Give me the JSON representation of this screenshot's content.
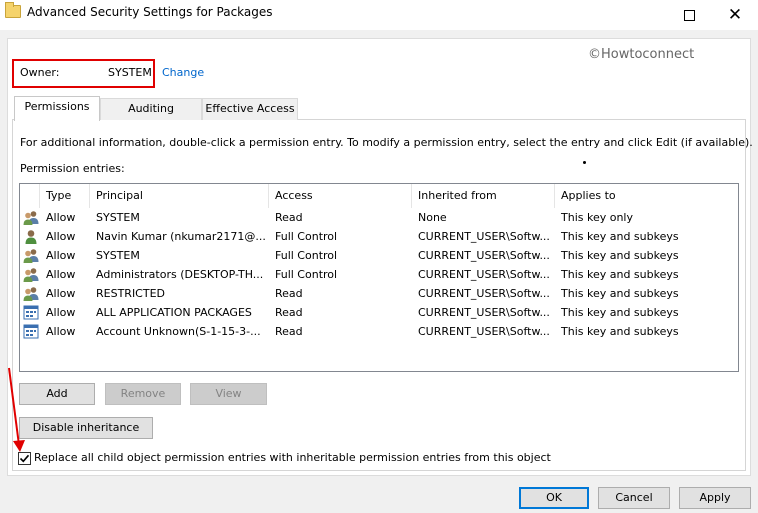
{
  "window": {
    "title": "Advanced Security Settings for Packages",
    "controls": {
      "maximize_icon": "maximize-icon",
      "close_label": "✕"
    }
  },
  "watermark": "©Howtoconnect",
  "owner": {
    "label": "Owner:",
    "value": "SYSTEM",
    "change_link": "Change",
    "highlight_color": "#e00000"
  },
  "tabs": [
    {
      "label": "Permissions",
      "active": true
    },
    {
      "label": "Auditing",
      "active": false
    },
    {
      "label": "Effective Access",
      "active": false
    }
  ],
  "info_text": "For additional information, double-click a permission entry. To modify a permission entry, select the entry and click Edit (if available).",
  "entries_label": "Permission entries:",
  "table": {
    "columns": [
      "Type",
      "Principal",
      "Access",
      "Inherited from",
      "Applies to"
    ],
    "rows": [
      {
        "icon": "group-icon",
        "type": "Allow",
        "principal": "SYSTEM",
        "access": "Read",
        "inherited": "None",
        "applies": "This key only"
      },
      {
        "icon": "user-icon",
        "type": "Allow",
        "principal": "Navin Kumar (nkumar2171@...",
        "access": "Full Control",
        "inherited": "CURRENT_USER\\Softw...",
        "applies": "This key and subkeys"
      },
      {
        "icon": "group-icon",
        "type": "Allow",
        "principal": "SYSTEM",
        "access": "Full Control",
        "inherited": "CURRENT_USER\\Softw...",
        "applies": "This key and subkeys"
      },
      {
        "icon": "group-icon",
        "type": "Allow",
        "principal": "Administrators (DESKTOP-TH...",
        "access": "Full Control",
        "inherited": "CURRENT_USER\\Softw...",
        "applies": "This key and subkeys"
      },
      {
        "icon": "group-icon",
        "type": "Allow",
        "principal": "RESTRICTED",
        "access": "Read",
        "inherited": "CURRENT_USER\\Softw...",
        "applies": "This key and subkeys"
      },
      {
        "icon": "app-package-icon",
        "type": "Allow",
        "principal": "ALL APPLICATION PACKAGES",
        "access": "Read",
        "inherited": "CURRENT_USER\\Softw...",
        "applies": "This key and subkeys"
      },
      {
        "icon": "app-package-icon",
        "type": "Allow",
        "principal": "Account Unknown(S-1-15-3-...",
        "access": "Read",
        "inherited": "CURRENT_USER\\Softw...",
        "applies": "This key and subkeys"
      }
    ]
  },
  "buttons": {
    "add": "Add",
    "remove": "Remove",
    "view": "View",
    "disable_inheritance": "Disable inheritance",
    "ok": "OK",
    "cancel": "Cancel",
    "apply": "Apply"
  },
  "replace_checkbox": {
    "label": "Replace all child object permission entries with inheritable permission entries from this object",
    "checked": true
  },
  "colors": {
    "accent": "#0078d7",
    "link": "#0066cc",
    "annotation_arrow": "#e00000"
  }
}
